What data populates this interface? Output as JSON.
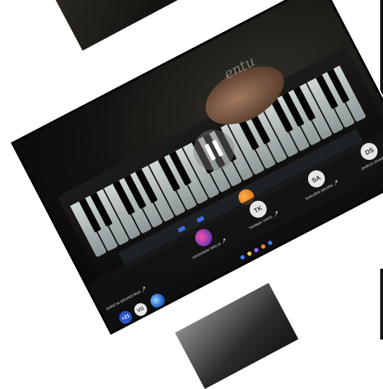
{
  "participants": [
    {
      "name": "SHREYA SRIVASTAVA",
      "initials": "",
      "kind": "self"
    },
    {
      "name": "KRISHNAV WALIA",
      "initials": "",
      "kind": "photo"
    },
    {
      "name": "TANMAY KAPIL",
      "initials": "TK",
      "kind": "initials"
    },
    {
      "name": "SHAURIA ARORA",
      "initials": "SA",
      "kind": "initials"
    },
    {
      "name": "DHRUV SHARMA",
      "initials": "DS",
      "kind": "initials"
    }
  ],
  "toolbar": {
    "more_count": "+21",
    "vg_initials": "VG"
  },
  "colors": {
    "accent_blue": "#2b55c9",
    "knob_orange": "#f08a24"
  },
  "icons": {
    "play_pause": "pause-icon",
    "mic": "mic-icon"
  }
}
